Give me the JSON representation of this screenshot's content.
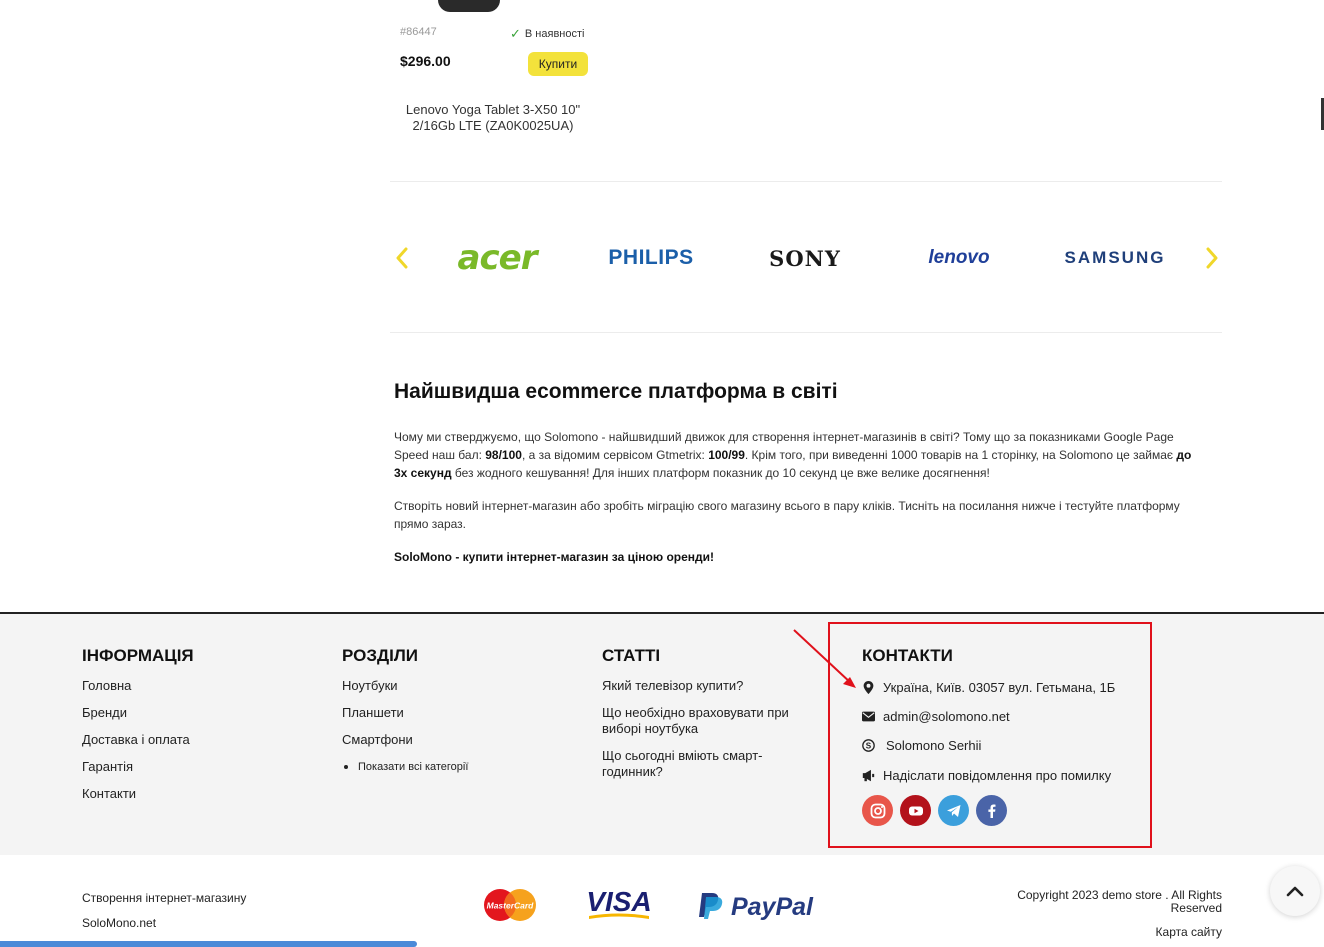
{
  "product": {
    "sku": "#86447",
    "stock": "В наявності",
    "price": "$296.00",
    "buy_label": "Купити",
    "name": "Lenovo Yoga Tablet 3-X50 10\" 2/16Gb LTE (ZA0K0025UA)"
  },
  "brands": [
    "acer",
    "PHILIPS",
    "SONY",
    "lenovo",
    "SAMSUNG"
  ],
  "article": {
    "title": "Найшвидша ecommerce платформа в світі",
    "p1_a": "Чому ми стверджуємо, що Solomono - найшвидший движок для створення інтернет-магазинів в світі? Тому що за показниками Google Page Speed наш бал: ",
    "p1_b": "98/100",
    "p1_c": ", а за відомим сервісом Gtmetrix: ",
    "p1_d": "100/99",
    "p1_e": ". Крім того, при виведенні 1000 товарів на 1 сторінку, на Solomono це займає ",
    "p1_f": "до 3х секунд",
    "p1_g": " без жодного кешування! Для інших платформ показник до 10 секунд це вже велике досягнення!",
    "p2": "Створіть новий інтернет-магазин або зробіть міграцію свого магазину всього в пару кліків. Тисніть на посилання нижче і тестуйте платформу прямо зараз.",
    "p3": "SoloMono - купити інтернет-магазин за ціною оренди!"
  },
  "footer": {
    "info": {
      "title": "ІНФОРМАЦІЯ",
      "links": [
        "Головна",
        "Бренди",
        "Доставка і оплата",
        "Гарантія",
        "Контакти"
      ]
    },
    "sections": {
      "title": "РОЗДІЛИ",
      "links": [
        "Ноутбуки",
        "Планшети",
        "Смартфони"
      ],
      "show_all": "Показати всі категорії"
    },
    "articles": {
      "title": "СТАТТІ",
      "links": [
        "Який телевізор купити?",
        "Що необхідно враховувати при виборі ноутбука",
        "Що сьогодні вміють смарт-годинник?"
      ]
    },
    "contacts": {
      "title": "КОНТАКТИ",
      "address": "Україна, Київ. 03057 вул. Гетьмана, 1Б",
      "email": "admin@solomono.net",
      "skype": "Solomono Serhii",
      "report": "Надіслати повідомлення про помилку",
      "socials": [
        "instagram-icon",
        "youtube-icon",
        "telegram-icon",
        "facebook-icon"
      ]
    }
  },
  "bottom": {
    "link1": "Створення інтернет-магазину",
    "link2": "SoloMono.net",
    "payments": [
      "MasterCard",
      "VISA",
      "PayPal"
    ],
    "copyright": "Copyright 2023 demo store . All Rights Reserved",
    "sitemap": "Карта сайту"
  },
  "colors": {
    "accent_yellow": "#f3e23b",
    "highlight_red": "#e0111b",
    "instagram": "#e8564a",
    "youtube": "#b3121b",
    "telegram": "#3b9fdc",
    "facebook": "#4a64a8"
  }
}
